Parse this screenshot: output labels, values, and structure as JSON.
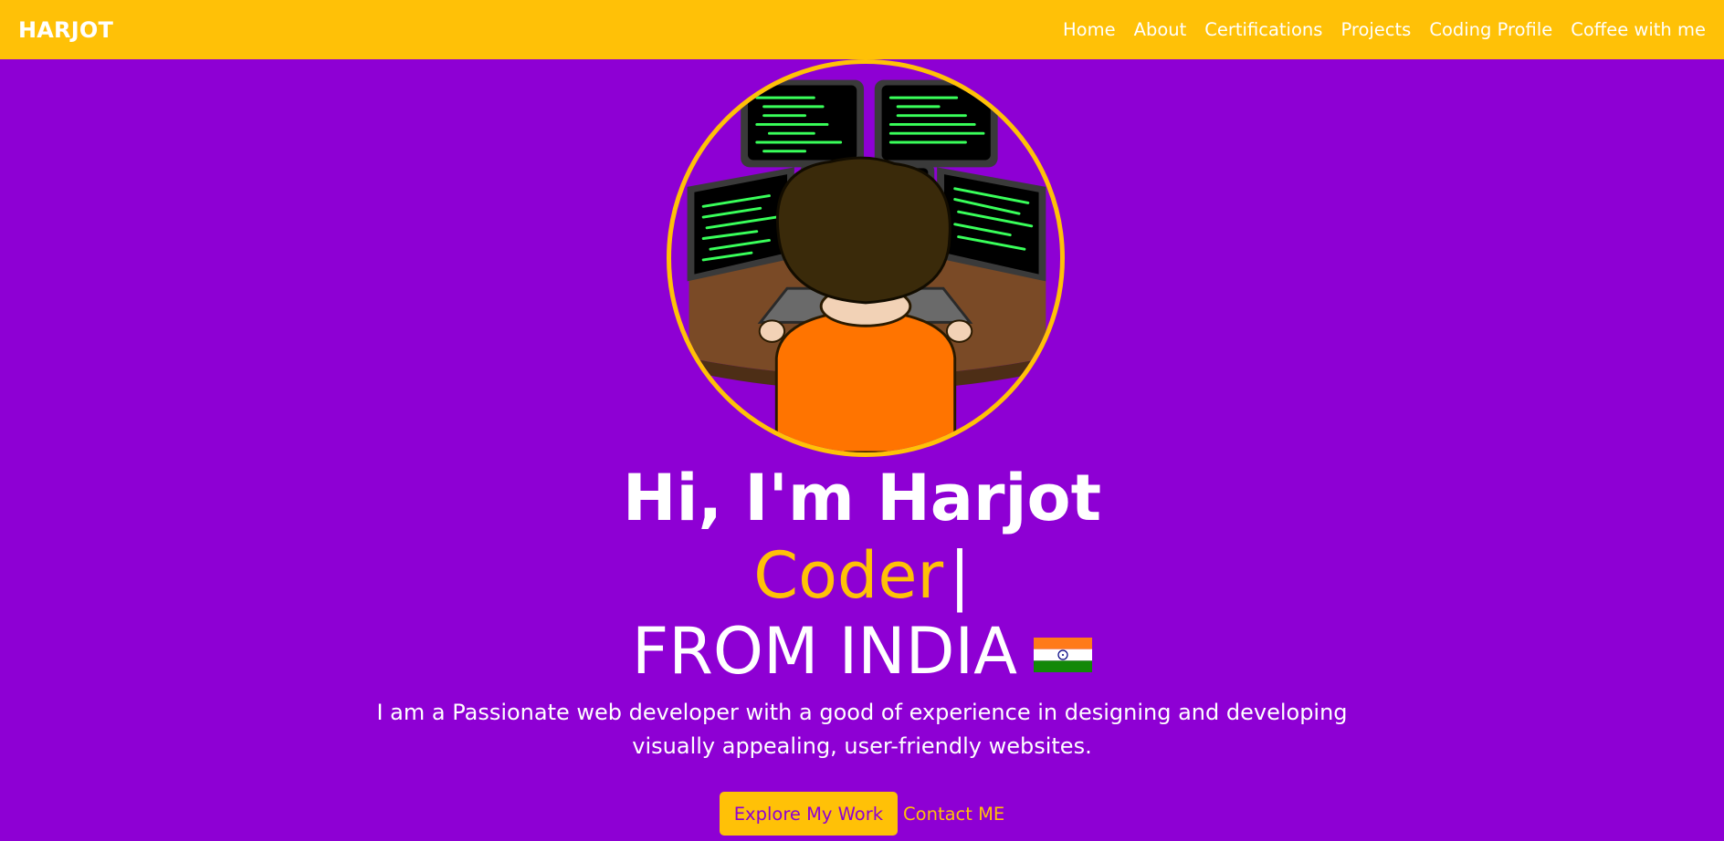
{
  "navbar": {
    "brand": "HARJOT",
    "links": [
      "Home",
      "About",
      "Certifications",
      "Projects",
      "Coding Profile",
      "Coffee with me"
    ]
  },
  "hero": {
    "greeting": "Hi, I'm Harjot",
    "typed_word": "Coder",
    "typed_cursor": "|",
    "origin": "FROM INDIA",
    "description": "I am a Passionate web developer with a good of experience in designing and developing visually appealing, user-friendly websites.",
    "explore_label": "Explore My Work",
    "contact_label": "Contact ME"
  },
  "colors": {
    "accent": "#ffc107",
    "background": "#8e00d4",
    "text": "#ffffff"
  },
  "icons": {
    "avatar": "coder-avatar-illustration",
    "flag": "india-flag-icon"
  }
}
